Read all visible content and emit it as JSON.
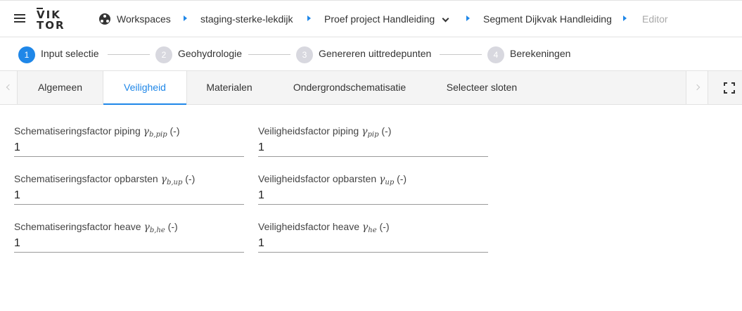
{
  "app": {
    "logo": {
      "line1": "VIK",
      "line2": "TOR"
    }
  },
  "breadcrumb": [
    {
      "label": "Workspaces"
    },
    {
      "label": "staging-sterke-lekdijk"
    },
    {
      "label": "Proef project Handleiding"
    },
    {
      "label": "Segment Dijkvak Handleiding"
    },
    {
      "label": "Editor"
    }
  ],
  "stepper": [
    {
      "number": "1",
      "label": "Input selectie",
      "active": true
    },
    {
      "number": "2",
      "label": "Geohydrologie",
      "active": false
    },
    {
      "number": "3",
      "label": "Genereren uittredepunten",
      "active": false
    },
    {
      "number": "4",
      "label": "Berekeningen",
      "active": false
    }
  ],
  "tabs": [
    {
      "label": "Algemeen"
    },
    {
      "label": "Veiligheid",
      "active": true
    },
    {
      "label": "Materialen"
    },
    {
      "label": "Ondergrondschematisatie"
    },
    {
      "label": "Selecteer sloten"
    }
  ],
  "form": {
    "left": [
      {
        "label": "Schematiseringsfactor piping",
        "symbol": "γ",
        "subscript": "b,pip",
        "unit": "(-)",
        "value": "1"
      },
      {
        "label": "Schematiseringsfactor opbarsten",
        "symbol": "γ",
        "subscript": "b,up",
        "unit": "(-)",
        "value": "1"
      },
      {
        "label": "Schematiseringsfactor heave",
        "symbol": "γ",
        "subscript": "b,he",
        "unit": "(-)",
        "value": "1"
      }
    ],
    "right": [
      {
        "label": "Veiligheidsfactor piping",
        "symbol": "γ",
        "subscript": "pip",
        "unit": "(-)",
        "value": "1"
      },
      {
        "label": "Veiligheidsfactor opbarsten",
        "symbol": "γ",
        "subscript": "up",
        "unit": "(-)",
        "value": "1"
      },
      {
        "label": "Veiligheidsfactor heave",
        "symbol": "γ",
        "subscript": "he",
        "unit": "(-)",
        "value": "1"
      }
    ]
  },
  "colors": {
    "accent": "#1f87e8",
    "inactive_step": "#d8d8df",
    "tabbar_bg": "#f4f4f4",
    "disabled_text": "#a9a9a9"
  },
  "icons": [
    "menu-icon",
    "workspace-icon",
    "breadcrumb-separator-icon",
    "chevron-down-icon",
    "chevron-left-icon",
    "chevron-right-icon",
    "fullscreen-icon"
  ]
}
